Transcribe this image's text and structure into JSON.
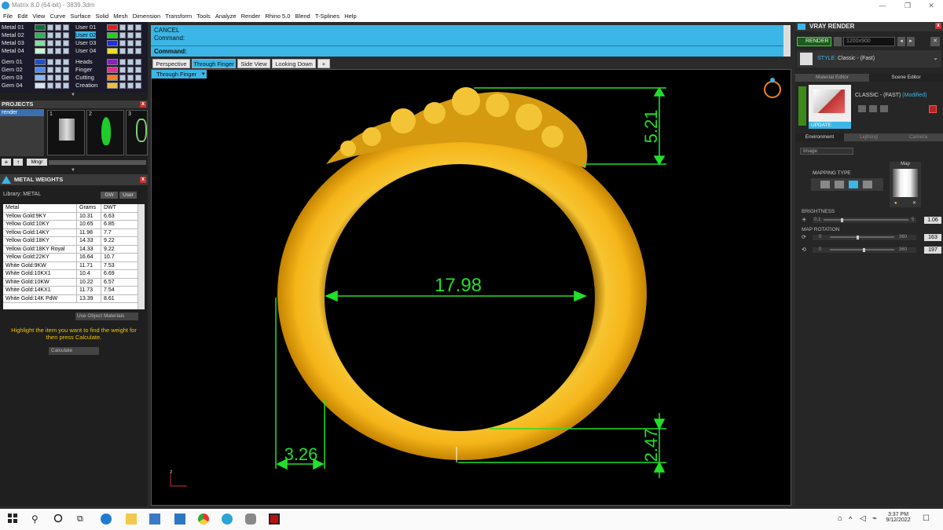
{
  "window": {
    "title": "Matrix 8.0 (64-bit) - 3839.3dm"
  },
  "menu": [
    "File",
    "Edit",
    "View",
    "Curve",
    "Surface",
    "Solid",
    "Mesh",
    "Dimension",
    "Transform",
    "Tools",
    "Analyze",
    "Render",
    "Rhino 5.0",
    "Blend",
    "T-Splines",
    "Help"
  ],
  "layers": {
    "metal": [
      "Metal 01",
      "Metal 02",
      "Metal 03",
      "Metal 04"
    ],
    "user": [
      "User 01",
      "User 02",
      "User 03",
      "User 04"
    ],
    "gem": [
      "Gem 01",
      "Gem 02",
      "Gem 03",
      "Gem 04"
    ],
    "other": [
      "Heads",
      "Finger",
      "Cutting",
      "Creation"
    ]
  },
  "projects": {
    "title": "PROJECTS",
    "item": "render",
    "thumbs": [
      "1",
      "2",
      "3"
    ],
    "mngr": "Mngr"
  },
  "metal_weights": {
    "title": "METAL WEIGHTS",
    "library": "Library: METAL",
    "gw": "GW",
    "user": "User",
    "headers": [
      "Metal",
      "Grams",
      "DWT"
    ],
    "rows": [
      [
        "Yellow Gold:9KY",
        "10.31",
        "6.63"
      ],
      [
        "Yellow Gold:10KY",
        "10.65",
        "6.85"
      ],
      [
        "Yellow Gold:14KY",
        "11.98",
        "7.7"
      ],
      [
        "Yellow Gold:18KY",
        "14.33",
        "9.22"
      ],
      [
        "Yellow Gold:18KY Royal",
        "14.33",
        "9.22"
      ],
      [
        "Yellow Gold:22KY",
        "16.64",
        "10.7"
      ],
      [
        "White Gold:9KW",
        "11.71",
        "7.53"
      ],
      [
        "White Gold:10KX1",
        "10.4",
        "6.69"
      ],
      [
        "White Gold:10KW",
        "10.22",
        "6.57"
      ],
      [
        "White Gold:14KX1",
        "11.73",
        "7.54"
      ],
      [
        "White Gold:14K PdW",
        "13.39",
        "8.61"
      ]
    ],
    "use_object": "Use Object Materials",
    "hint": "Highlight the item you want to find the weight for then press Calculate.",
    "calculate": "Calculate"
  },
  "command": {
    "cancel": "CANCEL",
    "command_line": "Command:",
    "prompt": "Command:"
  },
  "view_tabs": [
    "Perspective",
    "Through Finger",
    "Side View",
    "Looking Down",
    "+"
  ],
  "viewport": {
    "label": "Through Finger",
    "axis": "z"
  },
  "dimensions": {
    "top_height": "5.21",
    "inner_diameter": "17.98",
    "band_width": "3.26",
    "bottom_height": "2.47"
  },
  "vray": {
    "title": "VRAY RENDER",
    "render": "RENDER",
    "resolution": "1200x900",
    "style_label": "STYLE:",
    "style_value": "Classic - (Fast)",
    "editor_tabs": [
      "Material Editor",
      "Scene Editor"
    ],
    "preset": "CLASSIC - (FAST)",
    "modified": "(Modified)",
    "update": "UPDATE",
    "env_tabs": [
      "Environment",
      "Lighting",
      "Camera"
    ],
    "env_select": "Image",
    "mapping_type": "MAPPING TYPE",
    "map_label": "Map",
    "brightness": {
      "label": "BRIGHTNESS",
      "min": "0.1",
      "max": "5",
      "value": "1.06",
      "level": 0.2
    },
    "map_rotation": {
      "label": "MAP ROTATION",
      "min": "0",
      "max": "360",
      "value1": "163",
      "value2": "197"
    }
  },
  "taskbar": {
    "time": "3:37 PM",
    "date": "9/12/2022"
  },
  "colors": {
    "accent": "#3bb6e6",
    "dimension": "#22e02a",
    "gold": "#f0b21a"
  }
}
